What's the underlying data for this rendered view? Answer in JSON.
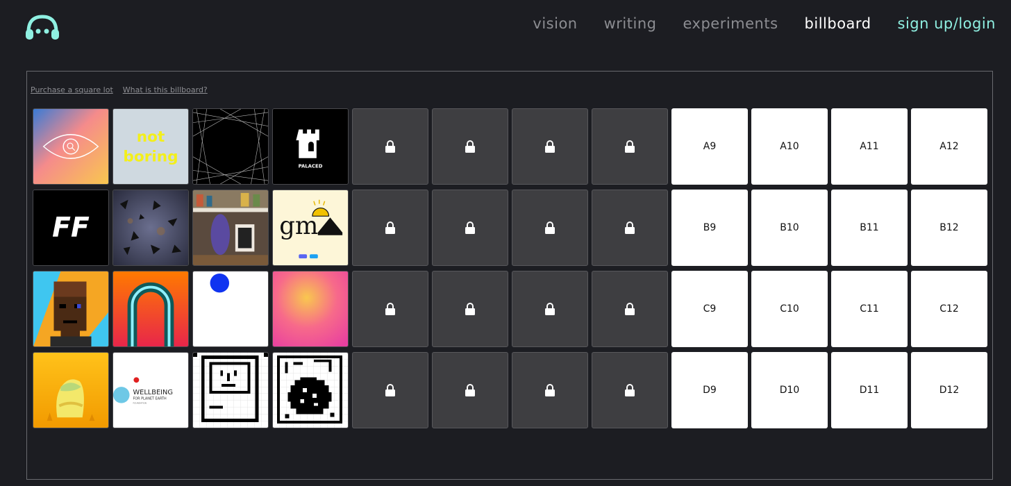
{
  "nav": {
    "items": [
      {
        "label": "vision"
      },
      {
        "label": "writing"
      },
      {
        "label": "experiments"
      },
      {
        "label": "billboard"
      },
      {
        "label": "sign up/login"
      }
    ]
  },
  "billboard": {
    "purchase_link": "Purchase a square lot",
    "about_link": "What is this billboard?",
    "rows": [
      {
        "row": "A",
        "open": [
          "A9",
          "A10",
          "A11",
          "A12"
        ]
      },
      {
        "row": "B",
        "open": [
          "B9",
          "B10",
          "B11",
          "B12"
        ]
      },
      {
        "row": "C",
        "open": [
          "C9",
          "C10",
          "C11",
          "C12"
        ]
      },
      {
        "row": "D",
        "open": [
          "D9",
          "D10",
          "D11",
          "D12"
        ]
      }
    ],
    "tile_text": {
      "not_boring": [
        "not",
        "boring"
      ],
      "palaced": "PALACED",
      "ff": "FF",
      "gm": "gm",
      "wellbeing": [
        "WELLBEING",
        "FOR PLANET EARTH",
        "FOUNDATION"
      ]
    }
  },
  "colors": {
    "background": "#1c1d22",
    "nav_muted": "#8c8d92",
    "nav_active": "#ffffff",
    "accent": "#8ff0e2",
    "locked_tile": "#3e3e41",
    "open_tile": "#ffffff"
  }
}
